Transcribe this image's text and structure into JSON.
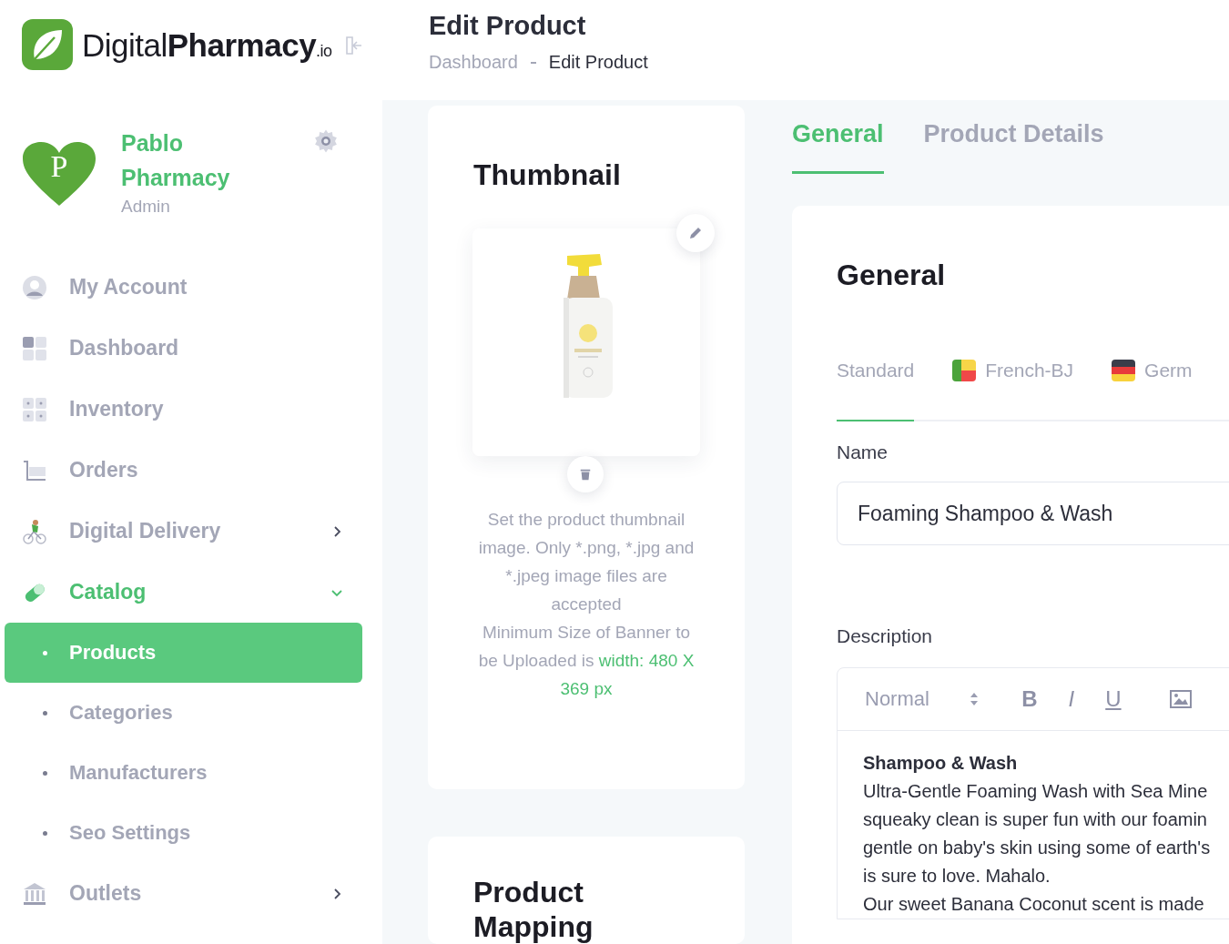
{
  "brand": {
    "name_light": "Digital",
    "name_bold": "Pharmacy",
    "suffix": ".io"
  },
  "user": {
    "initial": "P",
    "name": "Pablo Pharmacy",
    "role": "Admin"
  },
  "nav": [
    {
      "label": "My Account",
      "active": false
    },
    {
      "label": "Dashboard",
      "active": false
    },
    {
      "label": "Inventory",
      "active": false
    },
    {
      "label": "Orders",
      "active": false
    },
    {
      "label": "Digital Delivery",
      "active": false,
      "expanded": false
    },
    {
      "label": "Catalog",
      "active": true,
      "expanded": true,
      "children": [
        {
          "label": "Products",
          "selected": true
        },
        {
          "label": "Categories",
          "selected": false
        },
        {
          "label": "Manufacturers",
          "selected": false
        },
        {
          "label": "Seo Settings",
          "selected": false
        }
      ]
    },
    {
      "label": "Outlets",
      "active": false,
      "expanded": false
    }
  ],
  "header": {
    "title": "Edit Product",
    "breadcrumb": [
      "Dashboard",
      "Edit Product"
    ]
  },
  "thumbnail": {
    "title": "Thumbnail",
    "hint": "Set the product thumbnail image. Only *.png, *.jpg and *.jpeg image files are accepted",
    "size_note": "Minimum Size of Banner to be Uploaded is",
    "size_value": "width: 480 X 369 px"
  },
  "mapping": {
    "title": "Product Mapping"
  },
  "tabs": [
    {
      "label": "General",
      "selected": true
    },
    {
      "label": "Product Details",
      "selected": false
    }
  ],
  "general": {
    "title": "General",
    "languages": [
      {
        "label": "Standard",
        "selected": true,
        "kind": "plain"
      },
      {
        "label": "French-BJ",
        "selected": false,
        "kind": "split-flag"
      },
      {
        "label": "Germ",
        "selected": false,
        "kind": "striped-flag"
      }
    ],
    "name_label": "Name",
    "name_value": "Foaming Shampoo & Wash",
    "description_label": "Description",
    "editor": {
      "format": "Normal",
      "tools": [
        "B",
        "I",
        "U"
      ],
      "heading": "Shampoo & Wash",
      "lines": [
        "Ultra-Gentle Foaming Wash with Sea Mine",
        "squeaky clean is super fun with our foamin",
        "gentle on baby's skin using some of earth's",
        "is sure to love. Mahalo.",
        "Our sweet Banana Coconut scent is made"
      ]
    }
  }
}
